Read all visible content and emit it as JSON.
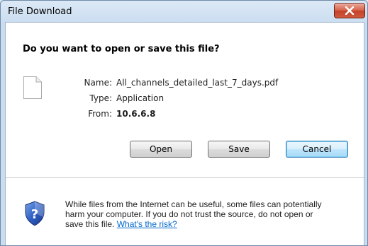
{
  "window": {
    "title": "File Download"
  },
  "dialog": {
    "question": "Do you want to open or save this file?",
    "file": {
      "name_label": "Name:",
      "name_value": "All_channels_detailed_last_7_days.pdf",
      "type_label": "Type:",
      "type_value": "Application",
      "from_label": "From:",
      "from_value": "10.6.6.8"
    },
    "buttons": {
      "open": "Open",
      "save": "Save",
      "cancel": "Cancel"
    },
    "warning": {
      "line1": "While files from the Internet can be useful, some files can potentially",
      "line2": "harm your computer. If you do not trust the source, do not open or",
      "line3_prefix": "save this file. ",
      "link": "What's the risk?"
    }
  },
  "icons": {
    "close": "close-icon",
    "file": "document-icon",
    "warning": "shield-question-icon"
  }
}
